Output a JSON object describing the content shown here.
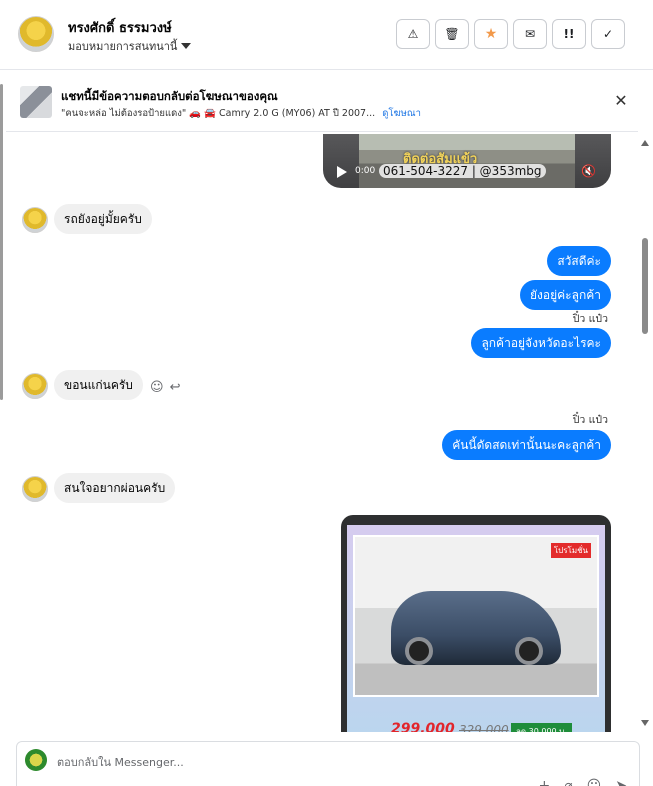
{
  "header": {
    "contact_name": "ทรงศักดิ์ ธรรมวงษ์",
    "assign_label": "มอบหมายการสนทนานี้",
    "actions": [
      {
        "name": "mark-spam-button",
        "icon": "warning-icon",
        "glyph": "⚠"
      },
      {
        "name": "delete-button",
        "icon": "trash-icon",
        "glyph": "🗑"
      },
      {
        "name": "star-button",
        "icon": "star-icon",
        "glyph": "★"
      },
      {
        "name": "mark-unread-button",
        "icon": "envelope-icon",
        "glyph": "✉"
      },
      {
        "name": "follow-up-button",
        "icon": "double-exclamation-icon",
        "glyph": "!!"
      },
      {
        "name": "mark-done-button",
        "icon": "check-icon",
        "glyph": "✓"
      }
    ],
    "star_color": "#f2994a"
  },
  "ad": {
    "title": "แชทนี้มีข้อความตอบกลับต่อโฆษณาของคุณ",
    "description": "\"คนจะหล่อ ไม่ต้องรอป้ายแดง\" 🚗 🚘 Camry 2.0 G (MY06) AT ปี 2007...",
    "link": "ดูโฆษณา"
  },
  "video": {
    "overlay_text": "ติดต่อสัมแข้ว",
    "phone": "061-504-3227 | @353mbg",
    "time": "0:00"
  },
  "messages": [
    {
      "dir": "in",
      "text": "รถยังอยู่มั้ยครับ"
    },
    {
      "dir": "out",
      "text": "สวัสดีค่ะ"
    },
    {
      "dir": "out",
      "text": "ยังอยู่ค่ะลูกค้า"
    },
    {
      "dir": "sender",
      "text": "ปิ๋ว แป๋ว"
    },
    {
      "dir": "out",
      "text": "ลูกค้าอยู่จังหวัดอะไรคะ"
    },
    {
      "dir": "in",
      "text": "ขอนแก่นครับ"
    },
    {
      "dir": "sender",
      "text": "ปิ๋ว แป๋ว"
    },
    {
      "dir": "out",
      "text": "คันนี้ดัดสดเท่านั้นนะคะลูกค้า"
    },
    {
      "dir": "in",
      "text": "สนใจอยากผ่อนครับ"
    }
  ],
  "car_card": {
    "badge": "โปรโมชั่น",
    "price_new": "299,000",
    "price_old": "329,000",
    "price_down": "ลด 30,000 บ."
  },
  "composer": {
    "placeholder": "ตอบกลับใน Messenger..."
  },
  "colors": {
    "outgoing_bubble": "#0a7cff",
    "incoming_bubble": "#f0f0f0",
    "link": "#1b74e4"
  }
}
